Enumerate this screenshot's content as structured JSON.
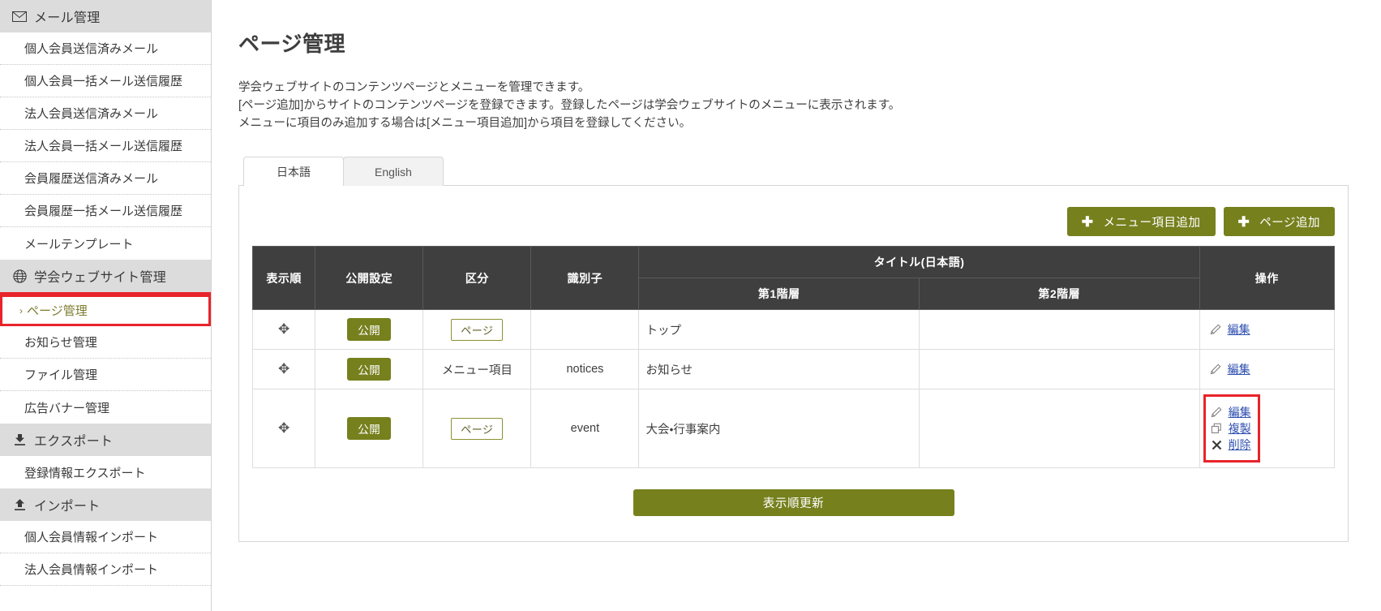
{
  "sidebar": {
    "groups": [
      {
        "icon": "mail-icon",
        "label": "メール管理",
        "items": [
          "個人会員送信済みメール",
          "個人会員一括メール送信履歴",
          "法人会員送信済みメール",
          "法人会員一括メール送信履歴",
          "会員履歴送信済みメール",
          "会員履歴一括メール送信履歴",
          "メールテンプレート"
        ]
      },
      {
        "icon": "globe-icon",
        "label": "学会ウェブサイト管理",
        "active_item": "ページ管理",
        "active_caret": "›",
        "items": [
          "お知らせ管理",
          "ファイル管理",
          "広告バナー管理"
        ]
      },
      {
        "icon": "download-icon",
        "label": "エクスポート",
        "items": [
          "登録情報エクスポート"
        ]
      },
      {
        "icon": "upload-icon",
        "label": "インポート",
        "items": [
          "個人会員情報インポート",
          "法人会員情報インポート"
        ]
      }
    ]
  },
  "main": {
    "title": "ページ管理",
    "description": [
      "学会ウェブサイトのコンテンツページとメニューを管理できます。",
      "[ページ追加]からサイトのコンテンツページを登録できます。登録したページは学会ウェブサイトのメニューに表示されます。",
      "メニューに項目のみ追加する場合は[メニュー項目追加]から項目を登録してください。"
    ],
    "tabs": [
      {
        "label": "日本語",
        "selected": true
      },
      {
        "label": "English",
        "selected": false
      }
    ],
    "buttons": {
      "add_menu_item": "メニュー項目追加",
      "add_page": "ページ追加",
      "plus_glyph": "✚",
      "update_order": "表示順更新"
    },
    "table": {
      "headers": {
        "order": "表示順",
        "publish": "公開設定",
        "kind": "区分",
        "identifier": "識別子",
        "title_group": "タイトル(日本語)",
        "level1": "第1階層",
        "level2": "第2階層",
        "operations": "操作"
      },
      "rows": [
        {
          "drag": "✥",
          "publish": "公開",
          "kind": "ページ",
          "kind_style": "badge",
          "identifier": "",
          "level1": "トップ",
          "level2": "",
          "ops": [
            {
              "icon": "pencil-icon",
              "label": "編集"
            }
          ],
          "highlighted": false
        },
        {
          "drag": "✥",
          "publish": "公開",
          "kind": "メニュー項目",
          "kind_style": "plain",
          "identifier": "notices",
          "level1": "お知らせ",
          "level2": "",
          "ops": [
            {
              "icon": "pencil-icon",
              "label": "編集"
            }
          ],
          "highlighted": false
        },
        {
          "drag": "✥",
          "publish": "公開",
          "kind": "ページ",
          "kind_style": "badge",
          "identifier": "event",
          "level1": "大会・行事案内",
          "level2": "",
          "ops": [
            {
              "icon": "pencil-icon",
              "label": "編集"
            },
            {
              "icon": "copy-icon",
              "label": "複製"
            },
            {
              "icon": "close-x-icon",
              "label": "削除"
            }
          ],
          "highlighted": true
        }
      ]
    }
  },
  "colors": {
    "accent_green": "#76801d",
    "highlight_red": "#e8232a",
    "header_dark": "#3f3f3f",
    "link_blue": "#2f50b0",
    "group_gray": "#dcdcdc"
  }
}
